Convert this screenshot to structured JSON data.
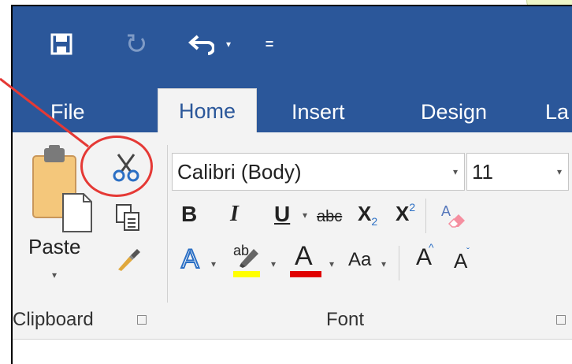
{
  "qat": {
    "save_icon": "save-icon",
    "redo_icon": "redo-icon",
    "undo_icon": "undo-icon",
    "undo_dropdown": "▾",
    "customize": "="
  },
  "tabs": [
    {
      "label": "File"
    },
    {
      "label": "Home"
    },
    {
      "label": "Insert"
    },
    {
      "label": "Design"
    },
    {
      "label": "La"
    }
  ],
  "clipboard": {
    "paste_label": "Paste",
    "group_label": "Clipboard"
  },
  "font": {
    "font_name": "Calibri (Body)",
    "font_size": "11",
    "bold": "B",
    "italic": "I",
    "underline": "U",
    "strikethrough": "abc",
    "subscript": "X",
    "subscript_mark": "2",
    "superscript": "X",
    "superscript_mark": "2",
    "highlight": "ab",
    "font_color": "A",
    "change_case": "Aa",
    "grow": "A",
    "shrink": "A",
    "group_label": "Font"
  },
  "colors": {
    "ribbon_blue": "#2b579a",
    "highlight_yellow": "#ffff00",
    "font_red": "#e00000",
    "annotation_red": "#e53935"
  }
}
